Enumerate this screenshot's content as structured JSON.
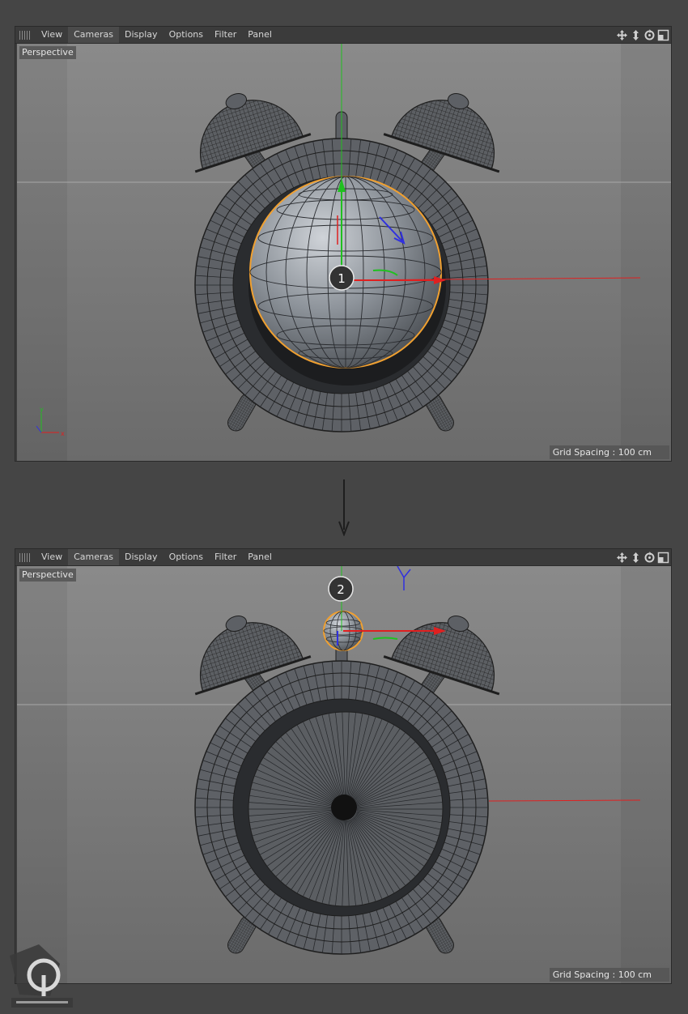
{
  "menu": {
    "items": [
      "View",
      "Cameras",
      "Display",
      "Options",
      "Filter",
      "Panel"
    ],
    "active_index": 1
  },
  "nav_icons": [
    "move-view-icon",
    "zoom-view-icon",
    "rotate-view-icon",
    "maximize-view-icon"
  ],
  "viewports": [
    {
      "camera_label": "Perspective",
      "grid_spacing": "Grid Spacing : 100 cm",
      "callout": "1",
      "selection": "inner dome sphere"
    },
    {
      "camera_label": "Perspective",
      "grid_spacing": "Grid Spacing : 100 cm",
      "callout": "2",
      "selection": "small top sphere"
    }
  ],
  "colors": {
    "background": "#454545",
    "viewport": "#7b7b7b",
    "selection": "#f0a030",
    "axis_x": "#e02020",
    "axis_y": "#20c020",
    "axis_z": "#3030e0"
  }
}
